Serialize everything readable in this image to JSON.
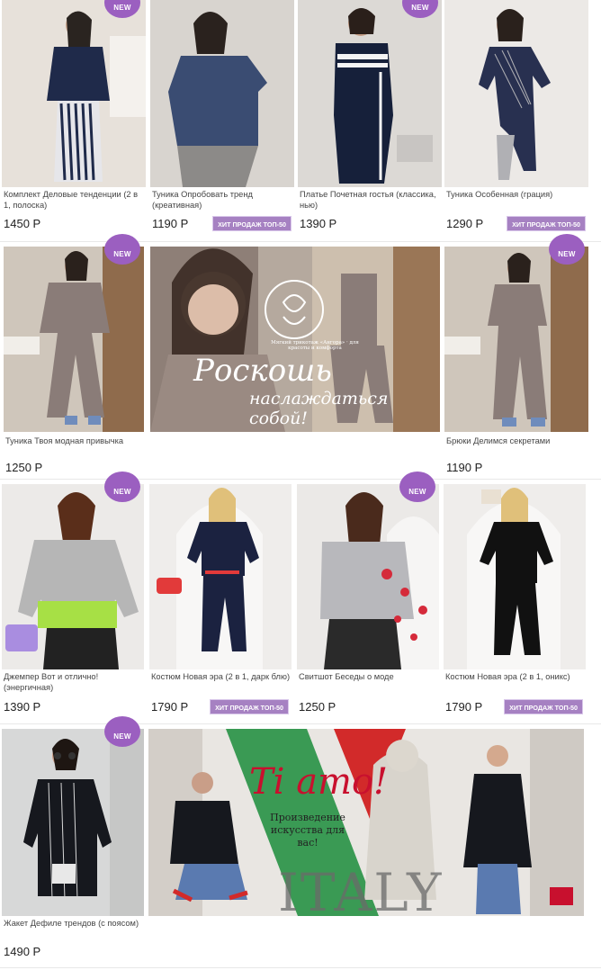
{
  "products": [
    {
      "title": "Комплект  Деловые тенденции (2 в 1, полоска)",
      "price": "1450 Р",
      "new": true,
      "hit": false,
      "colors": {
        "bg": "#e7e1da",
        "garment": "#1f2a4a",
        "accent": "#e6e6ea"
      }
    },
    {
      "title": "Туника Опробовать тренд (креативная)",
      "price": "1190 Р",
      "new": false,
      "hit": true,
      "colors": {
        "bg": "#d8d4cf",
        "garment": "#3a4c72",
        "accent": "#8c8a88"
      }
    },
    {
      "title": "Платье Почетная гостья (классика, нью)",
      "price": "1390 Р",
      "new": true,
      "hit": false,
      "colors": {
        "bg": "#dcd9d5",
        "garment": "#16203a",
        "accent": "#f4f4f4"
      }
    },
    {
      "title": "Туника Особенная (грация)",
      "price": "1290 Р",
      "new": false,
      "hit": true,
      "colors": {
        "bg": "#ece9e6",
        "garment": "#283050",
        "accent": "#b0b0b4"
      }
    },
    {
      "title": "Туника Твоя модная привычка",
      "price": "1250 Р",
      "new": true,
      "hit": false,
      "colors": {
        "bg": "#cfc6bb",
        "garment": "#8a7c78",
        "accent": "#6f8cbc"
      }
    },
    {
      "title": "Брюки Делимся секретами",
      "price": "1190 Р",
      "new": true,
      "hit": false,
      "colors": {
        "bg": "#cfc6bb",
        "garment": "#8a7c78",
        "accent": "#6f8cbc"
      }
    },
    {
      "title": "Джемпер Вот и отлично! (энергичная)",
      "price": "1390 Р",
      "new": true,
      "hit": false,
      "colors": {
        "bg": "#eceae8",
        "garment": "#b6b6b6",
        "accent": "#a7e045"
      }
    },
    {
      "title": "Костюм Новая эра (2 в 1, дарк блю)",
      "price": "1790 Р",
      "new": false,
      "hit": true,
      "colors": {
        "bg": "#efedeb",
        "garment": "#1b2240",
        "accent": "#e23a3a"
      }
    },
    {
      "title": "Свитшот Беседы о моде",
      "price": "1250 Р",
      "new": true,
      "hit": false,
      "colors": {
        "bg": "#ebe9e7",
        "garment": "#b8b8bc",
        "accent": "#d52a3a"
      }
    },
    {
      "title": "Костюм Новая эра (2 в 1, оникс)",
      "price": "1790 Р",
      "new": false,
      "hit": true,
      "colors": {
        "bg": "#efedeb",
        "garment": "#111111",
        "accent": "#e9e0d2"
      }
    },
    {
      "title": "Жакет Дефиле трендов (с поясом)",
      "price": "1490 Р",
      "new": true,
      "hit": false,
      "colors": {
        "bg": "#d7d8d8",
        "garment": "#16181e",
        "accent": "#ffffff"
      }
    }
  ],
  "badges": {
    "new": "NEW",
    "hit": "ХИТ ПРОДАЖ  ТОП-50"
  },
  "banner1": {
    "headline": "Роскошь",
    "subline": "наслаждаться собой!",
    "seal": "Мягкий трикотаж «Ангора» · для красоты и комфорта",
    "colors": {
      "bg": "#b5a99e",
      "text": "#ffffff",
      "garment": "#8a7c78"
    }
  },
  "banner2": {
    "headline": "Ti amo!",
    "subline": "Произведение искусства для вас!",
    "brand": "ITALY",
    "colors": {
      "green": "#3a9a54",
      "red": "#d22a2a",
      "headline": "#c8102e",
      "brand": "#6a6a6a",
      "bg": "#e9e6e2"
    }
  },
  "colors": {
    "badge": "#9b5fc0",
    "hit": "#a681c2"
  }
}
